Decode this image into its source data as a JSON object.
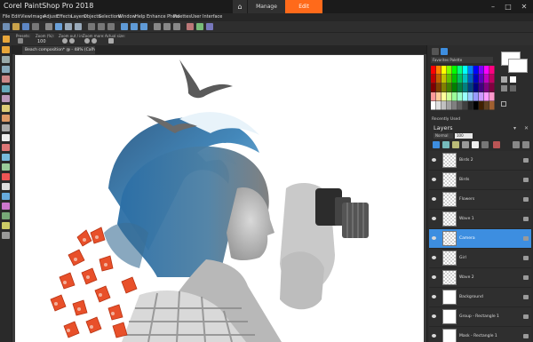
{
  "app": {
    "title": "Corel PaintShop Pro 2018"
  },
  "workspace_tabs": {
    "manage": "Manage",
    "edit": "Edit"
  },
  "menu": [
    "File",
    "Edit",
    "View",
    "Image",
    "Adjust",
    "Effects",
    "Layers",
    "Objects",
    "Selections",
    "Window",
    "Help",
    "Enhance Photo",
    "Palettes",
    "User Interface"
  ],
  "tool_options": {
    "labels": [
      "Presets:",
      "Zoom (%):",
      "Zoom out / in:",
      "Zoom more:",
      "Actual size:"
    ],
    "zoom_value": "100"
  },
  "document": {
    "tab_title": "Beach composition* @ - 48% (Camera)",
    "close_symbol": "×"
  },
  "materials": {
    "swatch_set": "Favorites Palette"
  },
  "recently_used": "Recently Used",
  "layers": {
    "title": "Layers",
    "blend_mode": "Normal",
    "opacity": "100",
    "items": [
      {
        "name": "Birds 2",
        "selected": false
      },
      {
        "name": "Birds",
        "selected": false
      },
      {
        "name": "Flowers",
        "selected": false
      },
      {
        "name": "Wave 1",
        "selected": false
      },
      {
        "name": "Camera",
        "selected": true
      },
      {
        "name": "Girl",
        "selected": false
      },
      {
        "name": "Wave 2",
        "selected": false
      },
      {
        "name": "Background",
        "selected": false
      },
      {
        "name": "Group - Rectangle 1",
        "selected": false
      },
      {
        "name": "Mask - Rectangle 1",
        "selected": false
      }
    ]
  },
  "colors": {
    "accent": "#ff6a1a",
    "selection": "#3d8ee0",
    "panel": "#2c2c2c",
    "palette": [
      "#ff0000",
      "#ff8000",
      "#ffff00",
      "#80ff00",
      "#00ff00",
      "#00ff80",
      "#00ffff",
      "#0080ff",
      "#0000ff",
      "#8000ff",
      "#ff00ff",
      "#ff0080",
      "#c00000",
      "#c06000",
      "#c0c000",
      "#60c000",
      "#00c000",
      "#00c060",
      "#00c0c0",
      "#0060c0",
      "#0000c0",
      "#6000c0",
      "#c000c0",
      "#c00060",
      "#800000",
      "#804000",
      "#808000",
      "#408000",
      "#008000",
      "#008040",
      "#008080",
      "#004080",
      "#000080",
      "#400080",
      "#800080",
      "#800040",
      "#ff9999",
      "#ffcc99",
      "#ffff99",
      "#ccff99",
      "#99ff99",
      "#99ffcc",
      "#99ffff",
      "#99ccff",
      "#9999ff",
      "#cc99ff",
      "#ff99ff",
      "#ff99cc",
      "#ffffff",
      "#e0e0e0",
      "#c0c0c0",
      "#a0a0a0",
      "#808080",
      "#606060",
      "#404040",
      "#202020",
      "#000000",
      "#402000",
      "#604020",
      "#a06030"
    ]
  }
}
